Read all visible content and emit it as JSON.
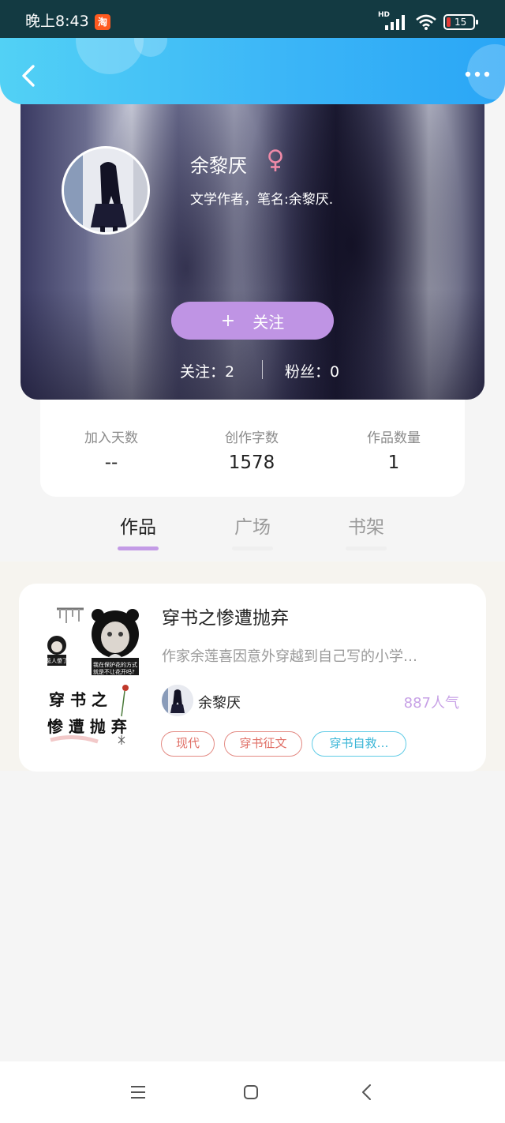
{
  "status_bar": {
    "time": "晚上8:43",
    "app_icon_glyph": "淘",
    "network_label": "HD",
    "battery_level": "15"
  },
  "header": {
    "back_icon": "chevron-left-icon",
    "more_icon": "more-dots-icon"
  },
  "profile": {
    "name": "余黎厌",
    "gender": "female",
    "gender_icon": "female-symbol-icon",
    "bio": "文学作者，笔名:余黎厌.",
    "follow_button": {
      "plus": "+",
      "label": "关注"
    },
    "following": "关注：2",
    "fans": "粉丝：0"
  },
  "stats": [
    {
      "label": "加入天数",
      "value": "--"
    },
    {
      "label": "创作字数",
      "value": "1578"
    },
    {
      "label": "作品数量",
      "value": "1"
    }
  ],
  "tabs": [
    {
      "label": "作品",
      "active": true
    },
    {
      "label": "广场",
      "active": false
    },
    {
      "label": "书架",
      "active": false
    }
  ],
  "works": [
    {
      "title": "穿书之惨遭抛弃",
      "description": "作家余莲喜因意外穿越到自己写的小学…",
      "author": "余黎厌",
      "popularity": "887人气",
      "cover_text": {
        "top_left": "惹人傻了",
        "top_right_1": "我在保护花的方式",
        "top_right_2": "就是不让花开吗?",
        "title_line_1": "穿 书 之",
        "title_line_2": "惨 遭 抛 弃"
      },
      "tags": [
        "现代",
        "穿书征文",
        "穿书自救…"
      ]
    }
  ],
  "colors": {
    "header_gradient_start": "#52d1f5",
    "header_gradient_end": "#2aa6f6",
    "follow_button": "#bf94e4",
    "active_tab_underline": "#c39be6",
    "popularity_text": "#c7a1e6",
    "tag_red": "#e06f66",
    "tag_cyan": "#38b5d6"
  },
  "bottom_nav": {
    "menu_icon": "menu-icon",
    "home_icon": "home-square-icon",
    "back_icon": "back-triangle-icon"
  }
}
